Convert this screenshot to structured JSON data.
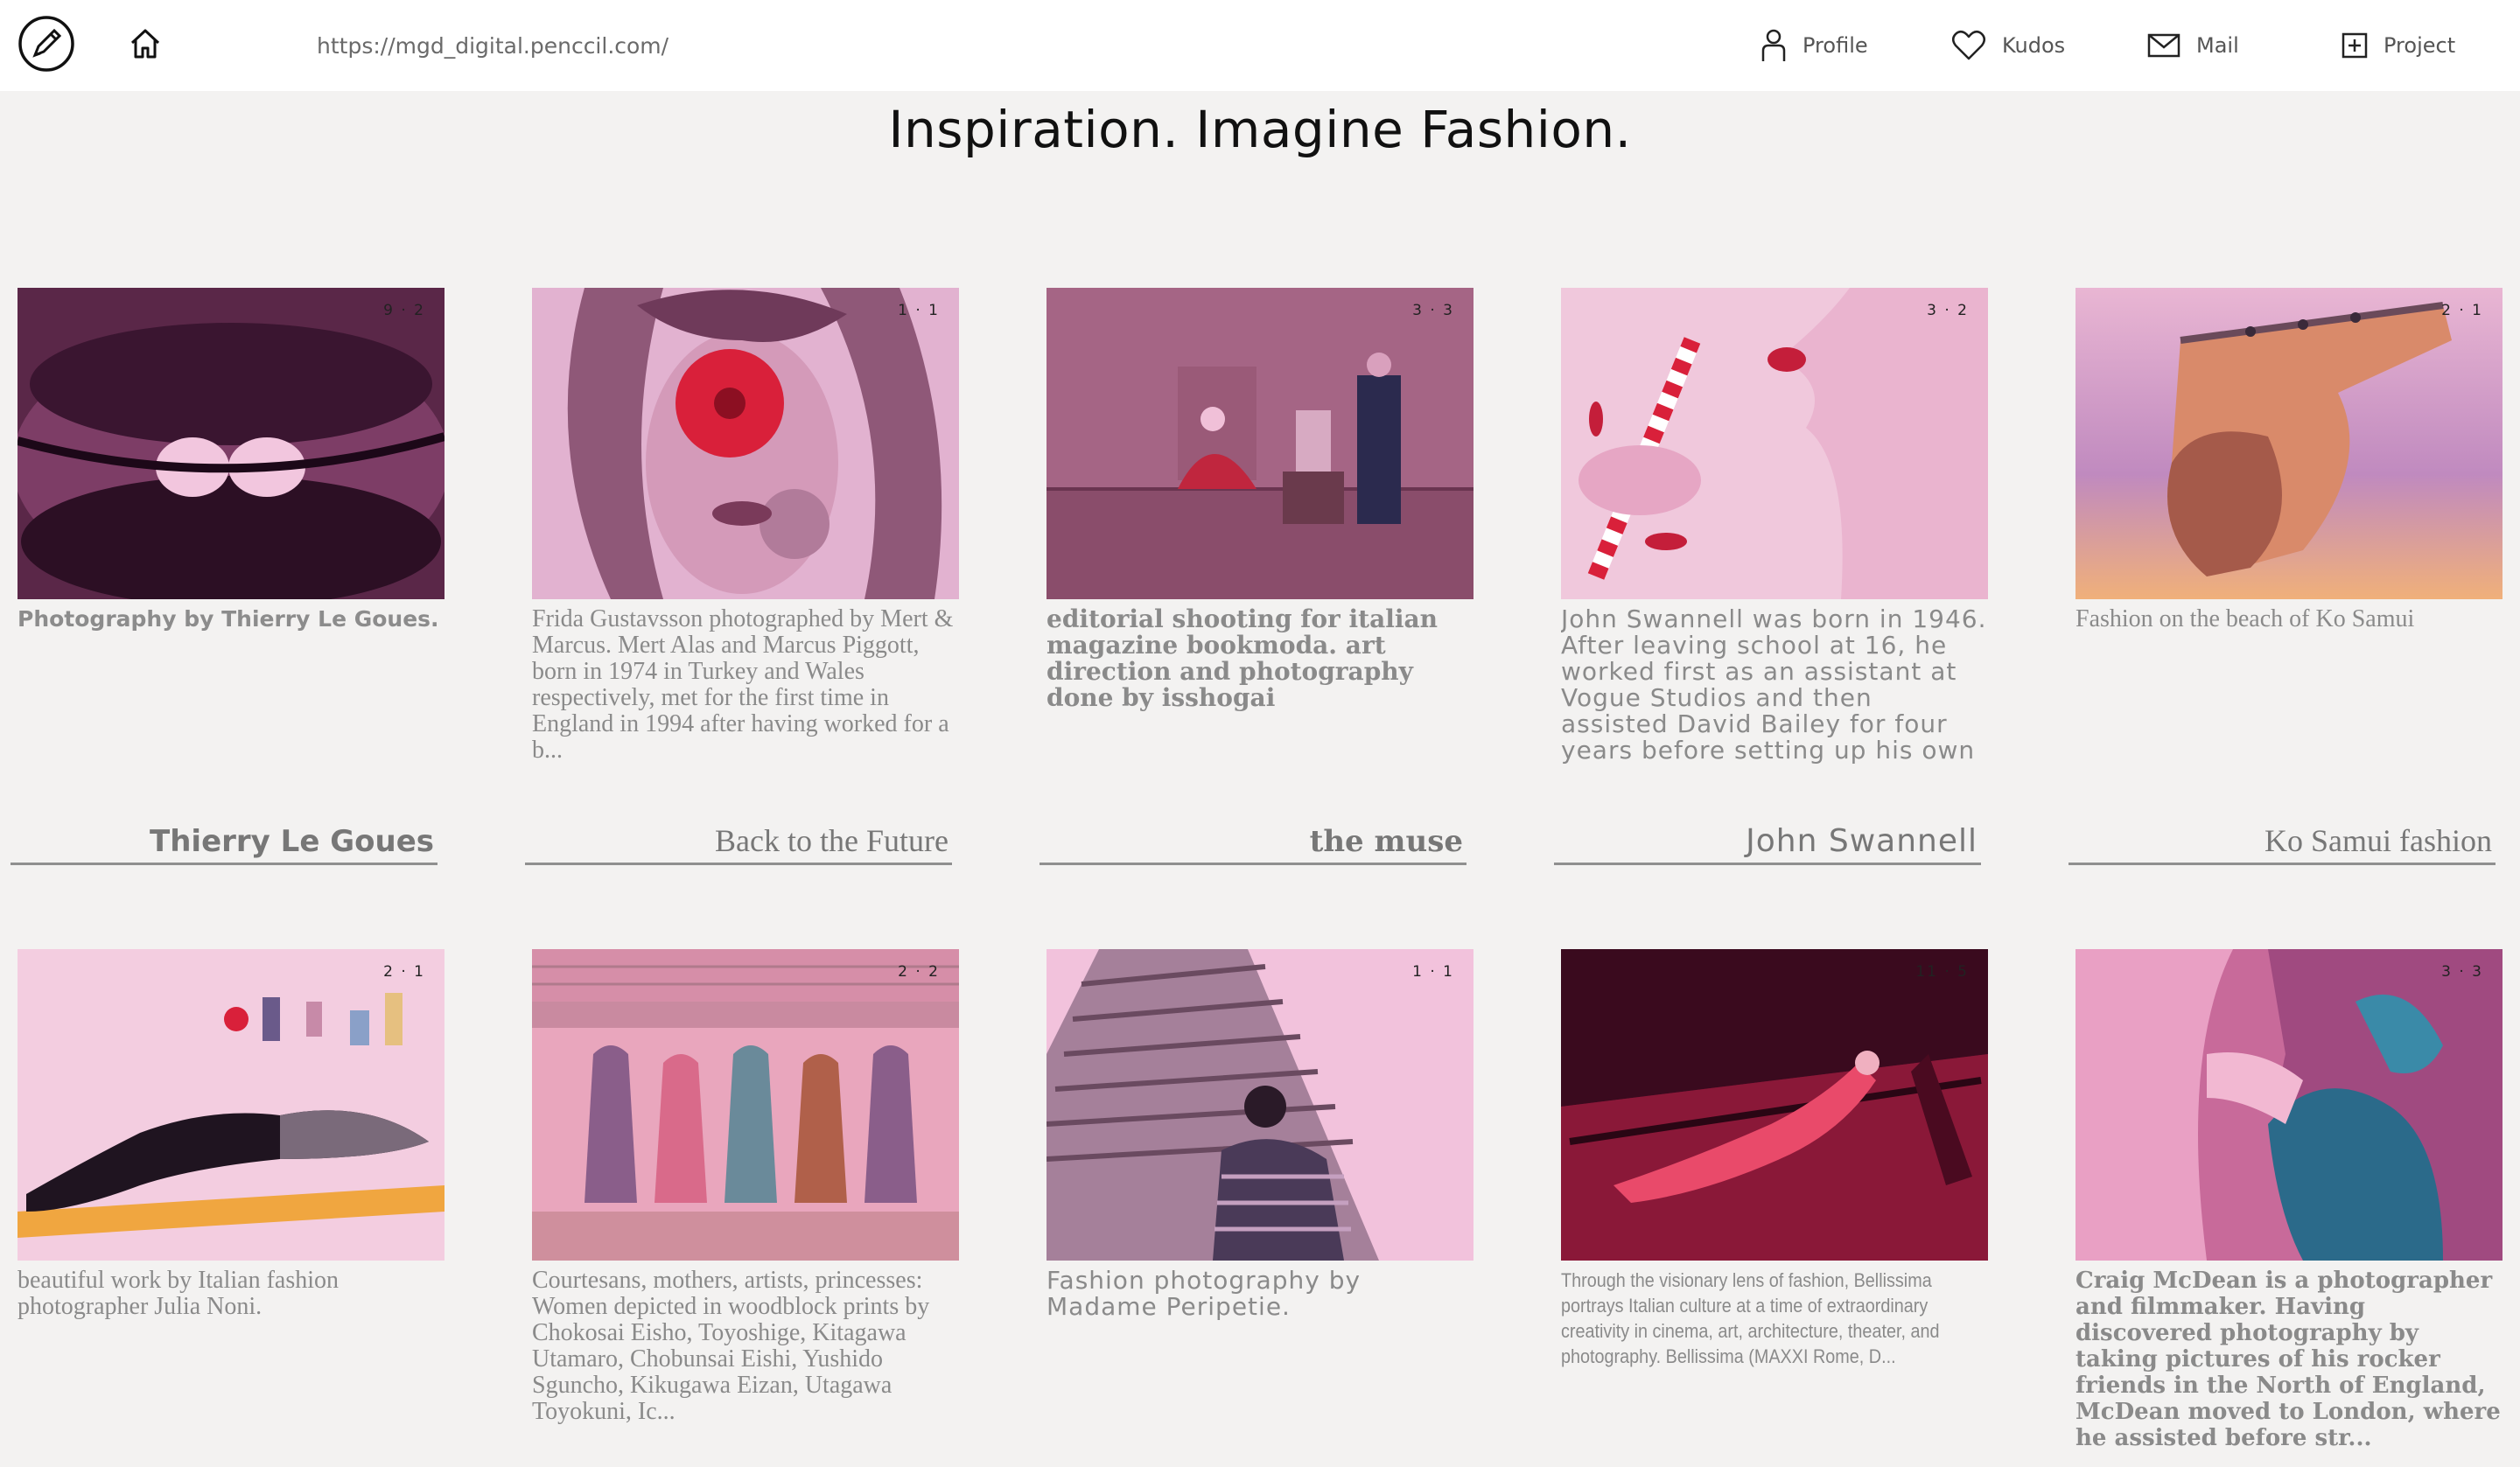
{
  "header": {
    "url": "https://mgd_digital.penccil.com/",
    "nav": {
      "profile": "Profile",
      "kudos": "Kudos",
      "mail": "Mail",
      "project": "Project"
    }
  },
  "page": {
    "title": "Inspiration. Imagine Fashion."
  },
  "row1": [
    {
      "count": "9 · 2",
      "desc": "Photography by Thierry Le Goues.",
      "album": "Thierry Le Goues"
    },
    {
      "count": "1 · 1",
      "desc": "Frida Gustavsson photographed by Mert & Marcus. Mert Alas and Marcus Piggott, born in 1974 in Turkey and Wales respectively, met for the first time in England in 1994 after having worked for a b...",
      "album": "Back to the Future"
    },
    {
      "count": "3 · 3",
      "desc": "editorial shooting for italian magazine bookmoda. art direction and photography done by isshogai",
      "album": "the muse"
    },
    {
      "count": "3 · 2",
      "desc": "John Swannell was born in 1946. After leaving school at 16, he worked first as an assistant at Vogue Studios and then assisted David Bailey for four years before setting up his own studio. He sp...",
      "album": "John Swannell"
    },
    {
      "count": "2 · 1",
      "desc": "Fashion on the beach of Ko Samui",
      "album": "Ko Samui fashion"
    }
  ],
  "row2": [
    {
      "count": "2 · 1",
      "desc": "beautiful work by Italian fashion photographer Julia Noni."
    },
    {
      "count": "2 · 2",
      "desc": "Courtesans, mothers, artists, princesses: Women depicted in woodblock prints by Chokosai Eisho, Toyoshige, Kitagawa Utamaro, Chobunsai Eishi, Yushido Sguncho, Kikugawa Eizan, Utagawa Toyokuni, Ic..."
    },
    {
      "count": "1 · 1",
      "desc": "Fashion photography by Madame Peripetie."
    },
    {
      "count": "11 · 5",
      "desc": "Through the visionary lens of fashion, Bellissima portrays Italian culture at a time of extraordinary creativity in cinema, art, architecture, theater, and photography. Bellissima (MAXXI Rome, D..."
    },
    {
      "count": "3 · 3",
      "desc": "Craig McDean is a photographer and filmmaker. Having discovered photography by taking pictures of his rocker friends in the North of England, McDean moved to London, where he assisted before str..."
    }
  ],
  "icons": [
    "pencil-logo-icon",
    "home-icon",
    "user-icon",
    "heart-icon",
    "mail-icon",
    "plus-square-icon"
  ],
  "colors": {
    "tint": "#e8a9cf",
    "accent_red": "#d9203a",
    "background": "#f3f2f1"
  }
}
